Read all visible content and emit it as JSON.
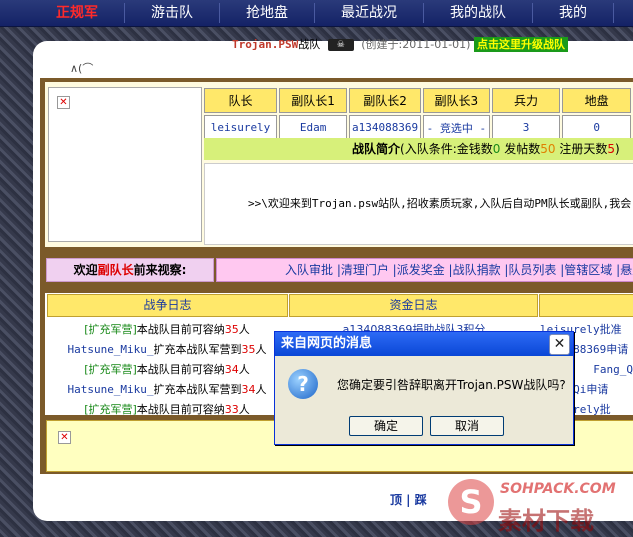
{
  "nav": {
    "items": [
      "正规军",
      "游击队",
      "抢地盘",
      "最近战况",
      "我的战队",
      "我的"
    ]
  },
  "clan": {
    "name": "Trojan.PSW",
    "suffix": "战队",
    "created": "(创建于:2011-01-01)",
    "upgrade": "点击这里升级战队",
    "tabmark": "∧(⌒"
  },
  "stats": {
    "headers": [
      "队长",
      "副队长1",
      "副队长2",
      "副队长3",
      "兵力",
      "地盘"
    ],
    "values": [
      "leisurely",
      "Edam",
      "a134088369",
      "- 竞选中 -",
      "3",
      "0"
    ]
  },
  "intro": {
    "title": "战队简介",
    "cond_prefix": "(入队条件:金钱数",
    "money": "0",
    "post_label": " 发帖数",
    "posts": "50",
    "days_label": " 注册天数",
    "days": "5",
    "close": ")"
  },
  "welcome_text": ">>\\欢迎来到Trojan.psw站队,招收素质玩家,入队后自动PM队长或副队,我会",
  "visitor": {
    "pre": "欢迎",
    "role": "副队长",
    "post": "前来视察:"
  },
  "admin_links": "入队审批 |清理门户 |派发奖金 |战队捐款 |队员列表 |管辖区域 |悬赏",
  "logs": {
    "war_title": "战争日志",
    "fund_title": "资金日志",
    "war": [
      {
        "user": "[扩充军营]",
        "text": "本战队目前可容纳",
        "num": "35",
        "unit": "人"
      },
      {
        "user": "Hatsune_Miku_",
        "text": "扩充本战队军营到",
        "num": "35",
        "unit": "人"
      },
      {
        "user": "[扩充军营]",
        "text": "本战队目前可容纳",
        "num": "34",
        "unit": "人"
      },
      {
        "user": "Hatsune_Miku_",
        "text": "扩充本战队军营到",
        "num": "34",
        "unit": "人"
      },
      {
        "user": "[扩充军营]",
        "text": "本战队目前可容纳",
        "num": "33",
        "unit": "人"
      }
    ],
    "fund_partial": "a134088369捐助战队3积分",
    "right": [
      "leisurely批准",
      "a134088369申请",
      "Fang_Q",
      "Fang_Qi申请",
      "leisurely批"
    ]
  },
  "footer": "顶 | 踩",
  "watermark": {
    "logo": "S",
    "site": "SOHPACK.COM",
    "cn": "素材下载"
  },
  "dialog": {
    "title": "来自网页的消息",
    "message": "您确定要引咎辞职离开Trojan.PSW战队吗?",
    "ok": "确定",
    "cancel": "取消",
    "close_glyph": "✕",
    "icon_glyph": "?"
  }
}
